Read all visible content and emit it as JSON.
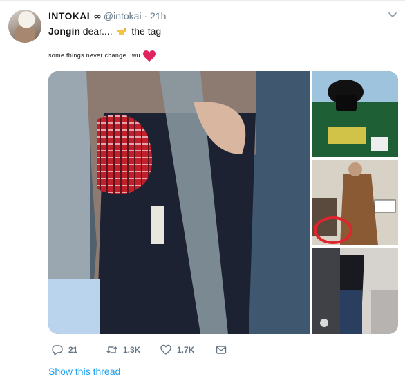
{
  "tweet": {
    "display_name": "INTOKAI",
    "name_suffix": "∞",
    "handle": "@intokai",
    "separator": "·",
    "time": "21h",
    "text_bold": "Jongin",
    "text_mid": " dear....",
    "text_end": " the tag",
    "subline": "some things never change uwu"
  },
  "actions": {
    "replies": "21",
    "retweets": "1.3K",
    "likes": "1.7K"
  },
  "thread_link": "Show this thread",
  "media": {
    "count": 4
  },
  "colors": {
    "link": "#1da1f2",
    "muted": "#657786",
    "heart": "#e0245e"
  },
  "icons": [
    "chevron-down-icon",
    "pointing-hand-emoji-icon",
    "red-heart-emoji-icon",
    "reply-icon",
    "retweet-icon",
    "like-icon",
    "direct-message-icon"
  ]
}
